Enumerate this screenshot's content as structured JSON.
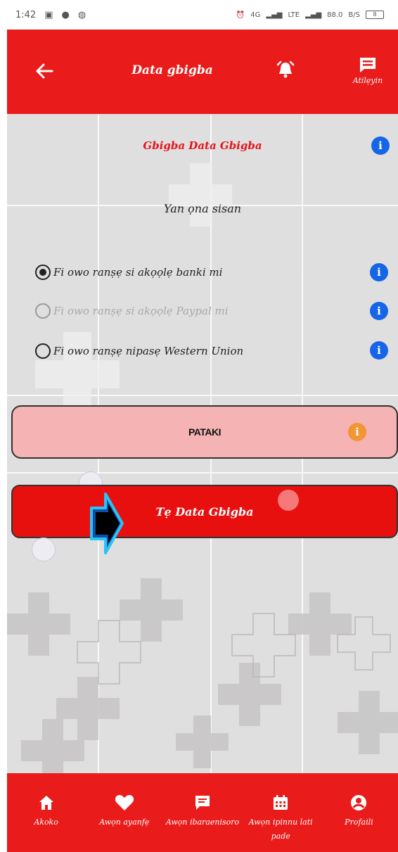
{
  "status_bar": {
    "time": "1:42",
    "network_label": "4G",
    "lte_label": "LTE",
    "speed": "88.0",
    "speed_unit": "B/S",
    "battery": "8"
  },
  "header": {
    "title": "Data gbigba",
    "messages_label": "Atilẹyin",
    "back_icon": "arrow-left-icon",
    "alarm_icon": "alarm-bell-icon",
    "messages_icon": "message-icon"
  },
  "section": {
    "title": "Gbigba Data Gbigba",
    "subtitle": "Yan ọna sisan"
  },
  "payment_options": [
    {
      "label": "Fi owo ranṣẹ si akọọlẹ banki mi",
      "selected": true,
      "enabled": true
    },
    {
      "label": "Fi owo ranṣẹ si akọọlẹ Paypal mi",
      "selected": false,
      "enabled": false
    },
    {
      "label": "Fi owo ranṣẹ nipasẹ Western Union",
      "selected": false,
      "enabled": true
    }
  ],
  "buttons": {
    "pataki": "PATAKI",
    "submit": "Tẹ Data Gbigba"
  },
  "info_glyph": "i",
  "bottom_nav": [
    {
      "label": "Akoko",
      "icon": "home-icon"
    },
    {
      "label": "Awọn ayanfẹ",
      "icon": "heart-icon"
    },
    {
      "label": "Awọn ibaraenisoro",
      "icon": "chat-icon"
    },
    {
      "label": "Awọn ipinnu lati pade",
      "icon": "calendar-icon"
    },
    {
      "label": "Profaili",
      "icon": "profile-icon"
    }
  ],
  "colors": {
    "primary_red": "#ea1b1b",
    "info_blue": "#1565e8",
    "warning_orange": "#f29533",
    "pataki_pink": "#f5b3b3"
  }
}
